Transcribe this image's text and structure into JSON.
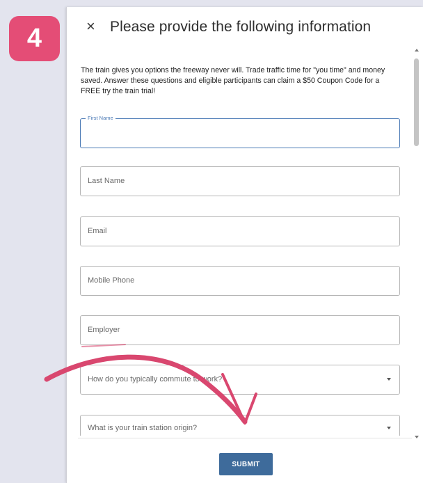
{
  "step": {
    "number": "4",
    "color": "#e44d76"
  },
  "dialog": {
    "close_icon": "close-icon",
    "close_glyph": "×",
    "title": "Please provide the following information",
    "intro": "The train gives you options the freeway never will. Trade traffic time for \"you time\" and money saved. Answer these questions and eligible participants can claim a $50 Coupon Code for a FREE try the train trial!"
  },
  "form": {
    "first_name": {
      "label": "First Name",
      "value": ""
    },
    "last_name": {
      "placeholder": "Last Name"
    },
    "email": {
      "placeholder": "Email"
    },
    "mobile_phone": {
      "placeholder": "Mobile Phone"
    },
    "employer": {
      "placeholder": "Employer"
    },
    "commute": {
      "placeholder": "How do you typically commute to work?"
    },
    "station_origin": {
      "placeholder": "What is your train station origin?"
    }
  },
  "submit": {
    "label": "SUBMIT",
    "color": "#3e6b9b"
  },
  "annotation": {
    "arrow_color": "#d9476f",
    "arrow_icon": "curved-arrow-icon"
  }
}
